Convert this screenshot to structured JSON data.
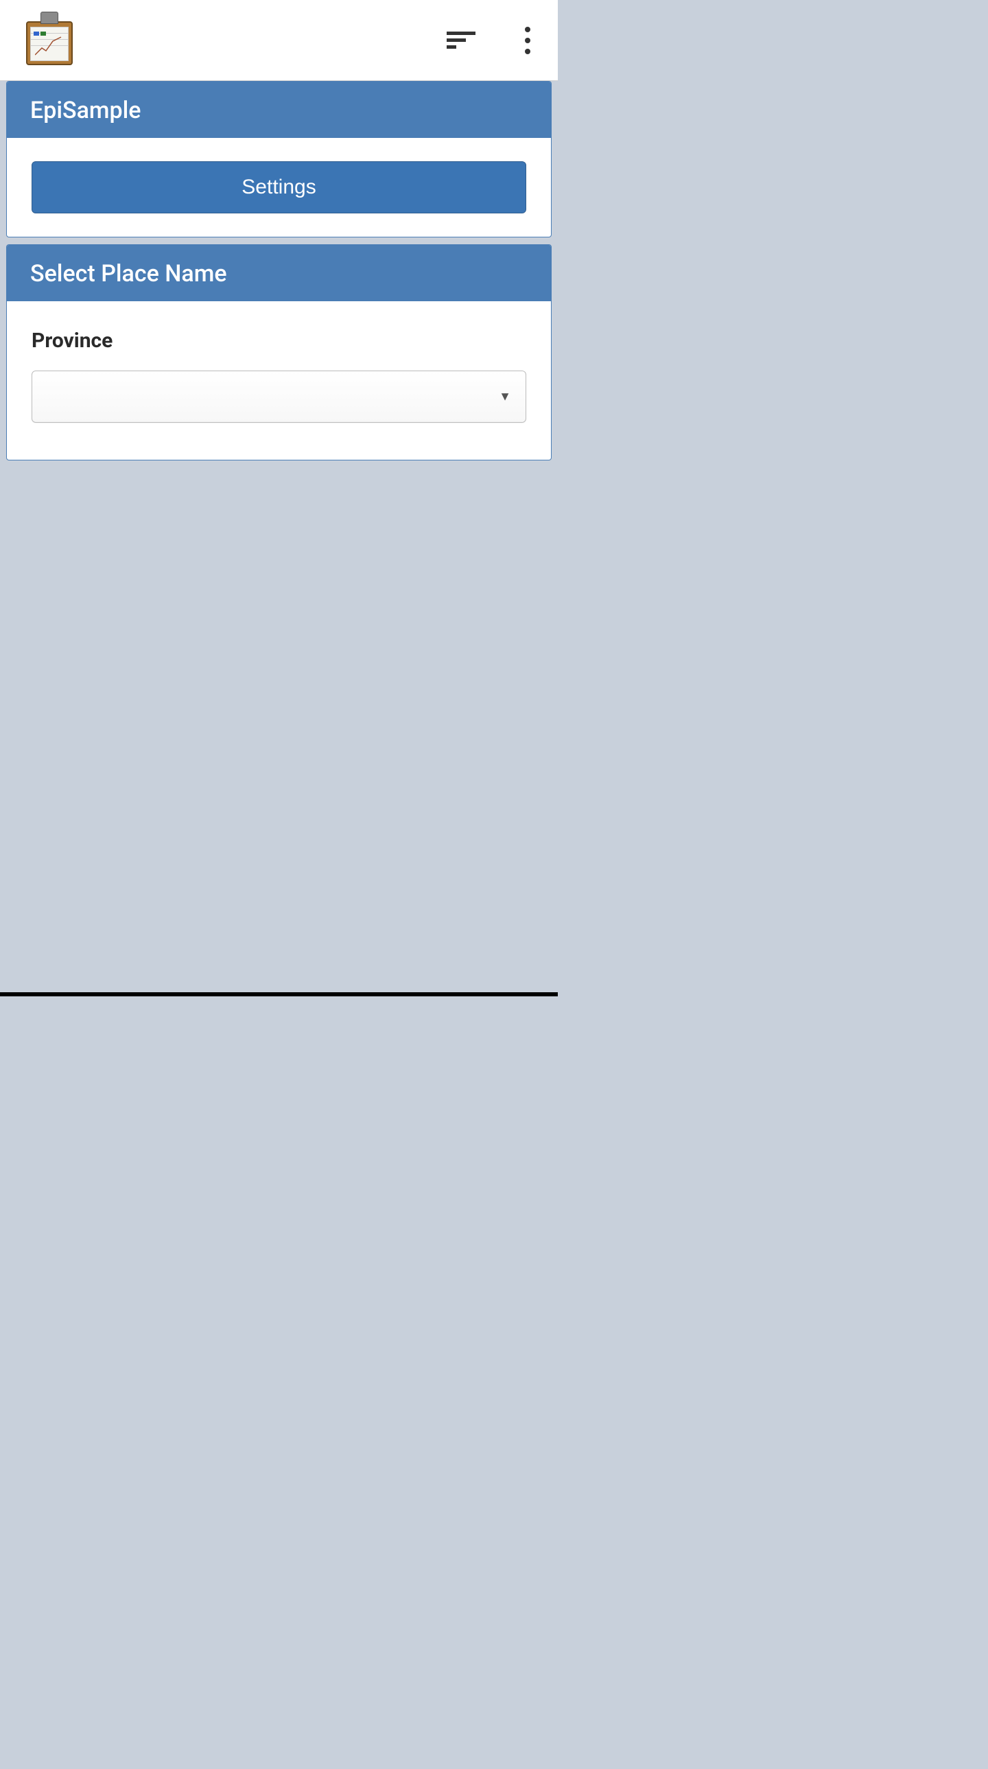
{
  "panels": {
    "app": {
      "title": "EpiSample",
      "settings_button_label": "Settings"
    },
    "place": {
      "title": "Select Place Name",
      "province_label": "Province",
      "province_value": ""
    }
  }
}
